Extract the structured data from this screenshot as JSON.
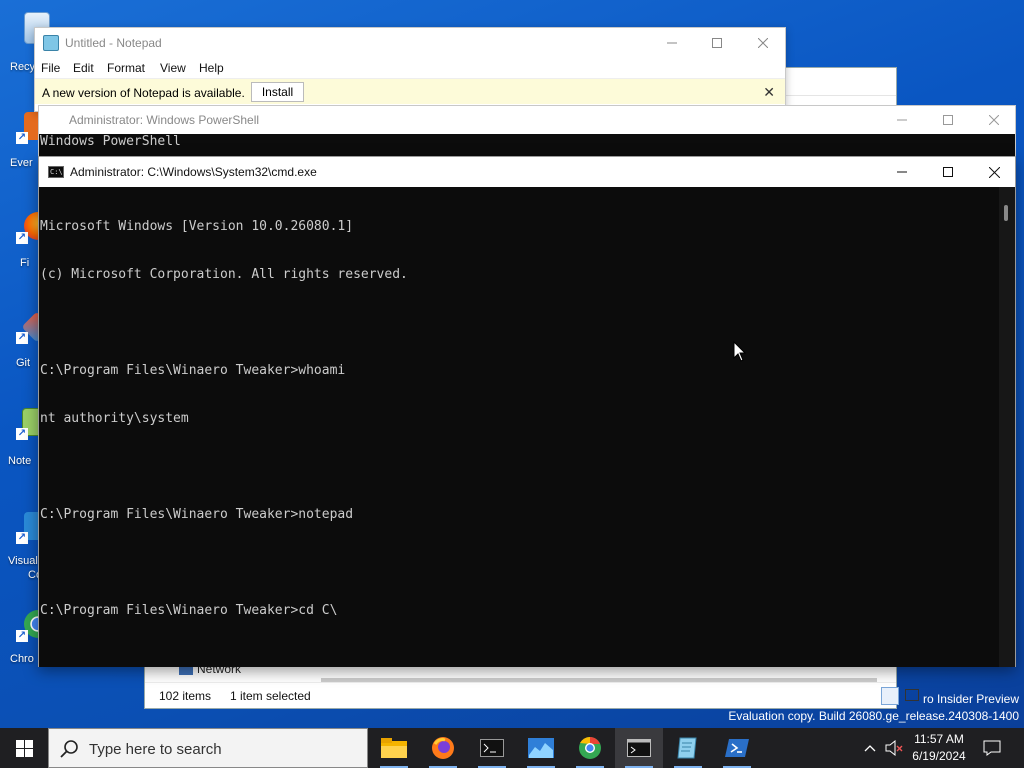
{
  "desktop": {
    "icons": [
      {
        "label": "Recy",
        "icon": "recycle-bin-icon"
      },
      {
        "label": "Ever",
        "icon": "everything-icon"
      },
      {
        "label": "Fi",
        "icon": "firefox-icon"
      },
      {
        "label": "Git",
        "icon": "git-icon"
      },
      {
        "label": "Note",
        "icon": "notepad-plus-plus-icon"
      },
      {
        "label": "Visual",
        "icon": "visual-studio-code-icon"
      },
      {
        "label": "Chro",
        "icon": "chrome-icon"
      }
    ],
    "watermark": {
      "line1": "ro Insider Preview",
      "line2": "Evaluation copy. Build 26080.ge_release.240308-1400"
    }
  },
  "explorer": {
    "nav_item": "Network",
    "status": {
      "items": "102 items",
      "selected": "1 item selected"
    }
  },
  "notepad": {
    "title": "Untitled - Notepad",
    "menu": [
      "File",
      "Edit",
      "Format",
      "View",
      "Help"
    ],
    "notice": {
      "message": "A new version of Notepad is available.",
      "button": "Install"
    }
  },
  "powershell": {
    "title": "Administrator: Windows PowerShell",
    "line1": "Windows PowerShell"
  },
  "cmd": {
    "title": "Administrator: C:\\Windows\\System32\\cmd.exe",
    "lines": [
      "Microsoft Windows [Version 10.0.26080.1]",
      "(c) Microsoft Corporation. All rights reserved.",
      "",
      "C:\\Program Files\\Winaero Tweaker>whoami",
      "nt authority\\system",
      "",
      "C:\\Program Files\\Winaero Tweaker>notepad",
      "",
      "C:\\Program Files\\Winaero Tweaker>cd C\\"
    ]
  },
  "taskbar": {
    "search_placeholder": "Type here to search",
    "apps": [
      "file-explorer-icon",
      "firefox-icon",
      "terminal-icon",
      "task-manager-icon",
      "chrome-icon",
      "cmd-icon",
      "notepad-icon",
      "powershell-icon"
    ],
    "clock": {
      "time": "11:57 AM",
      "date": "6/19/2024"
    }
  },
  "colors": {
    "desktop": "#0b55c0",
    "console_bg": "#0c0c0c",
    "console_fg": "#cccccc",
    "taskbar": "#1f1f22",
    "notice_bg": "#fdfbd9"
  }
}
